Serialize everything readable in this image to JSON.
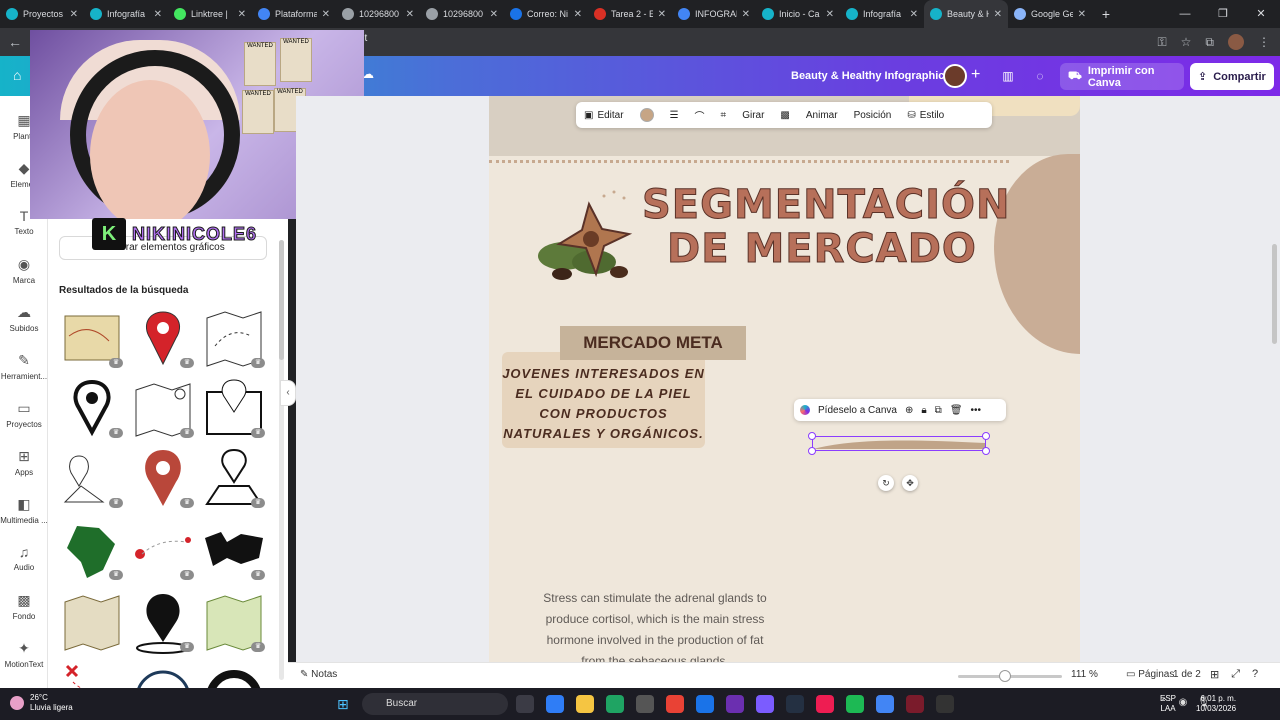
{
  "browser": {
    "tabs": [
      {
        "label": "Proyectos",
        "color": "#16b3c9"
      },
      {
        "label": "Infografía",
        "color": "#16b3c9"
      },
      {
        "label": "Linktree |",
        "color": "#43e660"
      },
      {
        "label": "Plataforma",
        "color": "#4285f4"
      },
      {
        "label": "10296800",
        "color": "#9aa0a6"
      },
      {
        "label": "10296800",
        "color": "#9aa0a6"
      },
      {
        "label": "Correo: Ni",
        "color": "#1a73e8"
      },
      {
        "label": "Tarea 2 - E",
        "color": "#d93025"
      },
      {
        "label": "INFOGRAF",
        "color": "#4285f4"
      },
      {
        "label": "Inicio - Ca",
        "color": "#16b3c9"
      },
      {
        "label": "Infografía",
        "color": "#16b3c9"
      },
      {
        "label": "Beauty & H",
        "color": "#16b3c9"
      },
      {
        "label": "Google Ge",
        "color": "#8ab4f8"
      }
    ],
    "new_tab": "+",
    "address_fragment": "lit"
  },
  "canva_header": {
    "design_title": "Beauty & Healthy Infographic",
    "print_label": "Imprimir con Canva",
    "share_label": "Compartir"
  },
  "rail": {
    "items": [
      {
        "label": "Plantil",
        "icon": "▦"
      },
      {
        "label": "Elemen",
        "icon": "◆"
      },
      {
        "label": "Texto",
        "icon": "T"
      },
      {
        "label": "Marca",
        "icon": "◉"
      },
      {
        "label": "Subidos",
        "icon": "☁"
      },
      {
        "label": "Herramient...",
        "icon": "✎"
      },
      {
        "label": "Proyectos",
        "icon": "▭"
      },
      {
        "label": "Apps",
        "icon": "⊞"
      },
      {
        "label": "Multimedia ...",
        "icon": "◧"
      },
      {
        "label": "Audio",
        "icon": "♫"
      },
      {
        "label": "Fondo",
        "icon": "▩"
      },
      {
        "label": "MotionText",
        "icon": "✦"
      }
    ]
  },
  "panel": {
    "generate_label": "Generar elementos gráficos",
    "results_title": "Resultados de la búsqueda"
  },
  "stream_overlay": {
    "logo_letter": "K",
    "name": "NIKINICOLE6",
    "posters": [
      "WANTED",
      "WANTED",
      "WANTED",
      "WANTED"
    ]
  },
  "toolbar": {
    "edit": "Editar",
    "rotate": "Girar",
    "animate": "Animar",
    "position": "Posición",
    "style": "Estilo"
  },
  "context_menu": {
    "ask_canva": "Pídeselo a Canva"
  },
  "slide": {
    "title_line1": "SEGMENTACIÓN",
    "title_line2": "DE MERCADO",
    "meta_title": "MERCADO META",
    "meta_desc": "JOVENES INTERESADOS EN EL CUIDADO DE LA PIEL CON PRODUCTOS NATURALES Y ORGÁNICOS.",
    "stress_text": "Stress can stimulate the adrenal glands to produce cortisol, which is the main stress hormone involved in the production of fat from the sebaceous glands."
  },
  "bottombar": {
    "notes": "Notas",
    "zoom": "111 %",
    "zoom_fraction": 0.45,
    "pages_label": "Páginas",
    "page_count": "1 de 2"
  },
  "taskbar": {
    "temp": "26°C",
    "weather": "Lluvia ligera",
    "search": "Buscar",
    "lang1": "ESP",
    "lang2": "LAA",
    "time": "6:01 p. m.",
    "date": "10/03/2026"
  },
  "colors": {
    "title_brown": "#b7705a",
    "page_bg": "#efe7db",
    "accent": "#7d2ae8"
  }
}
